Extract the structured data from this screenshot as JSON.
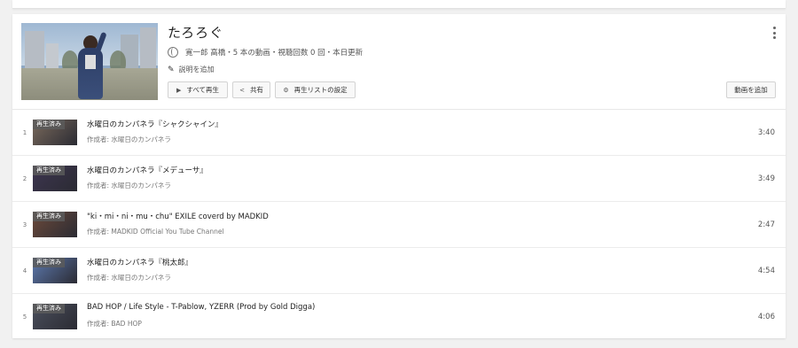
{
  "playlist": {
    "title": "たろろぐ",
    "meta": "寛一郎 高橋・5 本の動画・視聴回数 0 回・本日更新",
    "description_link": "説明を追加",
    "buttons": {
      "play_all": "すべて再生",
      "share": "共有",
      "settings": "再生リストの設定",
      "add_video": "動画を追加"
    },
    "icons": {
      "privacy": "globe-icon",
      "edit": "pencil-icon",
      "play": "play-icon",
      "share": "share-icon",
      "settings": "gear-icon",
      "menu": "more-vert-icon"
    }
  },
  "videos": [
    {
      "index": "1",
      "title": "水曜日のカンパネラ『シャクシャイン』",
      "author": "作成者: 水曜日のカンパネラ",
      "duration": "3:40",
      "watched_label": "再生済み",
      "thumb_color": "#7a6a5c"
    },
    {
      "index": "2",
      "title": "水曜日のカンパネラ『メデューサ』",
      "author": "作成者: 水曜日のカンパネラ",
      "duration": "3:49",
      "watched_label": "再生済み",
      "thumb_color": "#3d3550"
    },
    {
      "index": "3",
      "title": "\"ki・mi・ni・mu・chu\" EXILE coverd by MADKID",
      "author": "作成者: MADKID Official You Tube Channel",
      "duration": "2:47",
      "watched_label": "再生済み",
      "thumb_color": "#6c4a3a"
    },
    {
      "index": "4",
      "title": "水曜日のカンパネラ『桃太郎』",
      "author": "作成者: 水曜日のカンパネラ",
      "duration": "4:54",
      "watched_label": "再生済み",
      "thumb_color": "#5d7ab0"
    },
    {
      "index": "5",
      "title": "BAD HOP / Life Style - T-Pablow, YZERR (Prod by Gold Digga)",
      "author": "作成者: BAD HOP",
      "duration": "4:06",
      "watched_label": "再生済み",
      "thumb_color": "#4a4f5c"
    }
  ]
}
